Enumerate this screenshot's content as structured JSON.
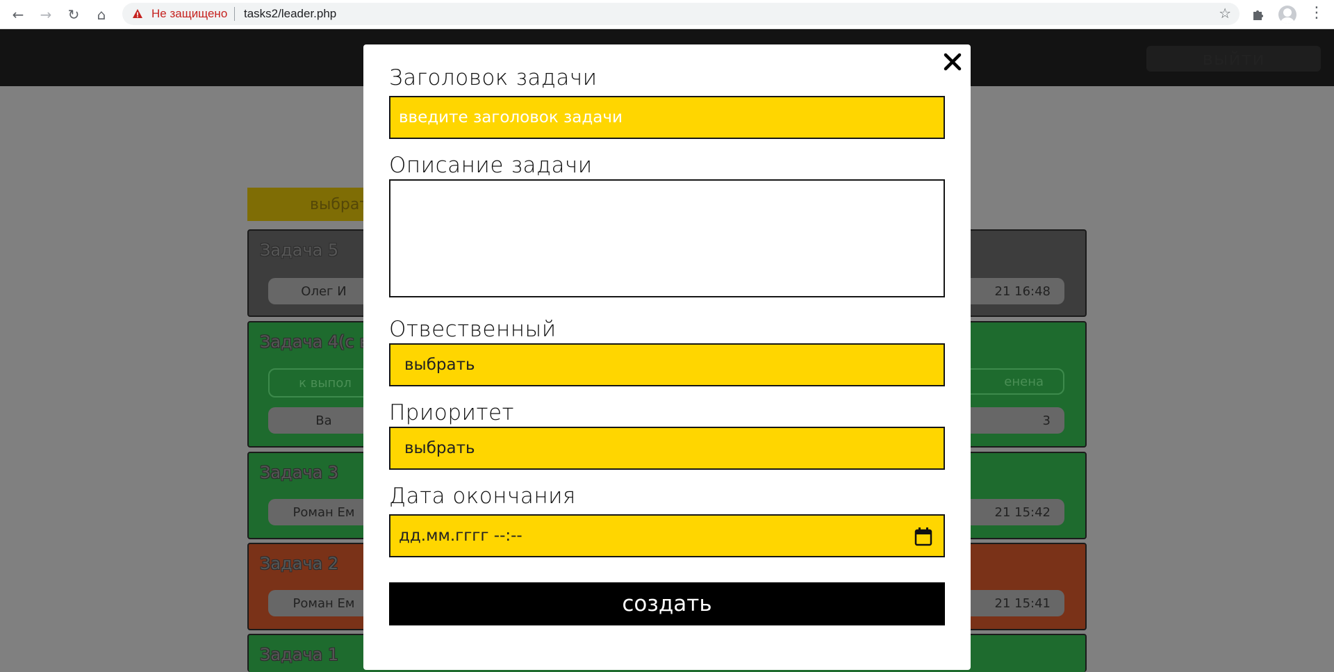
{
  "browser": {
    "not_secure_label": "Не защищено",
    "url": "tasks2/leader.php",
    "back_icon": "←",
    "forward_icon": "→",
    "reload_icon": "↻",
    "home_icon": "⌂",
    "star_icon": "☆",
    "menu_icon": "⋮"
  },
  "header": {
    "logout_label": "выйти"
  },
  "toolbar": {
    "filter_label": "выбрат"
  },
  "tasks": [
    {
      "title": "Задача 5",
      "person": "Олег И",
      "date": "21 16:48",
      "color": "#3d3d3d"
    },
    {
      "title": "Задача 4(с в",
      "status_left": "к выпол",
      "status_right": "енена",
      "person": "Ва",
      "date": "3",
      "color": "#1e6b2e"
    },
    {
      "title": "Задача 3",
      "person": "Роман Ем",
      "date": "21 15:42",
      "color": "#1e6b2e"
    },
    {
      "title": "Задача 2",
      "person": "Роман Ем",
      "date": "21 15:41",
      "color": "#7a3218"
    },
    {
      "title": "Задача 1",
      "color": "#1e6b2e"
    }
  ],
  "modal": {
    "title_label": "Заголовок задачи",
    "title_placeholder": "введите заголовок задачи",
    "description_label": "Описание задачи",
    "description_value": "",
    "responsible_label": "Отвественный",
    "responsible_value": "выбрать",
    "priority_label": "Приоритет",
    "priority_value": "выбрать",
    "end_date_label": "Дата окончания",
    "end_date_placeholder": "дд.мм.гггг --:--",
    "create_label": "создать",
    "accent_color": "#ffd600"
  }
}
